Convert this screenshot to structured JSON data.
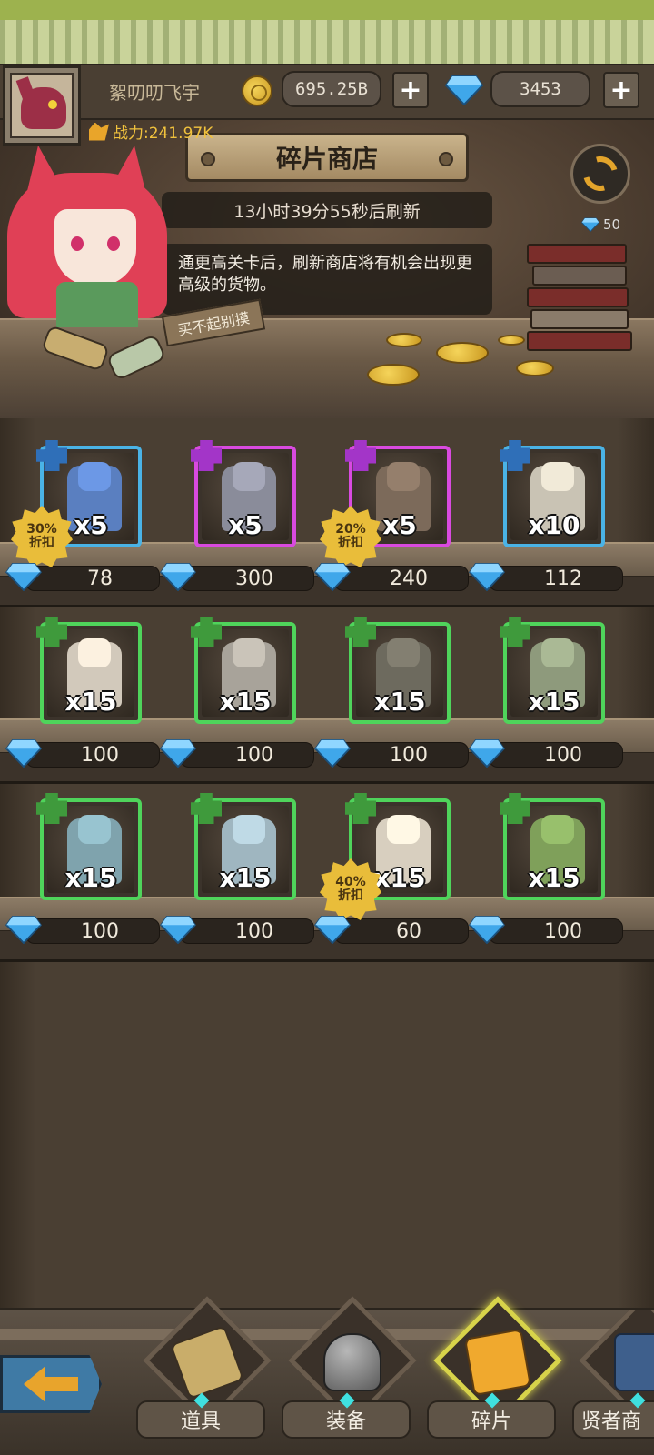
{
  "header": {
    "player_name": "絮叨叨飞宇",
    "coins": "695.25B",
    "gems": "3453",
    "power_label": "战力:241.97K"
  },
  "shop": {
    "title": "碎片商店",
    "refresh_timer": "13小时39分55秒后刷新",
    "refresh_cost": "50",
    "dialog": "通更高关卡后，刷新商店将有机会出现更高级的货物。",
    "sign": "买不起别摸"
  },
  "items": [
    {
      "qty": "x5",
      "price": "78",
      "rarity": "blue",
      "piece": "blue-puzzle-piece",
      "discount": [
        "30%",
        "折扣"
      ]
    },
    {
      "qty": "x5",
      "price": "300",
      "rarity": "purple",
      "piece": "purple-puzzle-piece"
    },
    {
      "qty": "x5",
      "price": "240",
      "rarity": "purple",
      "piece": "purple-puzzle-piece",
      "discount": [
        "20%",
        "折扣"
      ]
    },
    {
      "qty": "x10",
      "price": "112",
      "rarity": "blue",
      "piece": "blue-puzzle-piece"
    },
    {
      "qty": "x15",
      "price": "100",
      "rarity": "green",
      "piece": "green-puzzle-piece"
    },
    {
      "qty": "x15",
      "price": "100",
      "rarity": "green",
      "piece": "green-puzzle-piece"
    },
    {
      "qty": "x15",
      "price": "100",
      "rarity": "green",
      "piece": "green-puzzle-piece"
    },
    {
      "qty": "x15",
      "price": "100",
      "rarity": "green",
      "piece": "green-puzzle-piece"
    },
    {
      "qty": "x15",
      "price": "100",
      "rarity": "green",
      "piece": "green-puzzle-piece"
    },
    {
      "qty": "x15",
      "price": "100",
      "rarity": "green",
      "piece": "green-puzzle-piece"
    },
    {
      "qty": "x15",
      "price": "60",
      "rarity": "green",
      "piece": "green-puzzle-piece",
      "discount": [
        "40%",
        "折扣"
      ]
    },
    {
      "qty": "x15",
      "price": "100",
      "rarity": "green",
      "piece": "green-puzzle-piece"
    }
  ],
  "nav": {
    "tabs": [
      {
        "label": "道具",
        "icon": "scroll-icon"
      },
      {
        "label": "装备",
        "icon": "helmet-icon"
      },
      {
        "label": "碎片",
        "icon": "puzzle-piece-icon",
        "active": true
      },
      {
        "label": "贤者商",
        "icon": "dragon-icon"
      }
    ]
  },
  "colors": {
    "rarity_green": "#4fd45b",
    "rarity_blue": "#4ab3e6",
    "rarity_purple": "#d94ae0",
    "gold": "#e9bd3a"
  }
}
